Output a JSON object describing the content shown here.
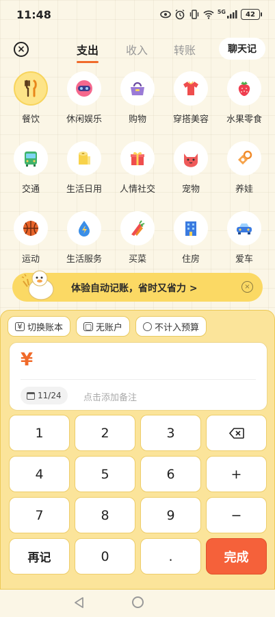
{
  "status_bar": {
    "time": "11:48",
    "battery": "42",
    "network": "5G"
  },
  "header": {
    "tabs": [
      {
        "label": "支出",
        "active": true
      },
      {
        "label": "收入",
        "active": false
      },
      {
        "label": "转账",
        "active": false
      }
    ],
    "chat_label": "聊天记"
  },
  "categories": [
    [
      {
        "label": "餐饮",
        "icon": "utensils-icon",
        "selected": true
      },
      {
        "label": "休闲娱乐",
        "icon": "vr-glasses-icon"
      },
      {
        "label": "购物",
        "icon": "handbag-icon"
      },
      {
        "label": "穿搭美容",
        "icon": "shirt-icon"
      },
      {
        "label": "水果零食",
        "icon": "strawberry-icon"
      }
    ],
    [
      {
        "label": "交通",
        "icon": "bus-icon"
      },
      {
        "label": "生活日用",
        "icon": "tissue-roll-icon"
      },
      {
        "label": "人情社交",
        "icon": "gift-icon"
      },
      {
        "label": "宠物",
        "icon": "cat-icon"
      },
      {
        "label": "养娃",
        "icon": "pacifier-icon"
      }
    ],
    [
      {
        "label": "运动",
        "icon": "basketball-icon"
      },
      {
        "label": "生活服务",
        "icon": "water-drop-icon"
      },
      {
        "label": "买菜",
        "icon": "vegetables-icon"
      },
      {
        "label": "住房",
        "icon": "building-icon"
      },
      {
        "label": "爱车",
        "icon": "car-icon"
      }
    ]
  ],
  "promo": {
    "text": "体验自动记账，省时又省力 >"
  },
  "options": {
    "switch_book": "切换账本",
    "no_account": "无账户",
    "no_budget": "不计入预算"
  },
  "entry": {
    "currency": "¥",
    "date": "11/24",
    "note_placeholder": "点击添加备注"
  },
  "keypad": {
    "keys": [
      "1",
      "2",
      "3",
      "",
      "4",
      "5",
      "6",
      "+",
      "7",
      "8",
      "9",
      "−",
      "再记",
      "0",
      ".",
      "完成"
    ]
  },
  "colors": {
    "accent": "#f06a2a",
    "panel": "#fbe49a",
    "promo": "#fbd964",
    "done": "#f5613a"
  }
}
